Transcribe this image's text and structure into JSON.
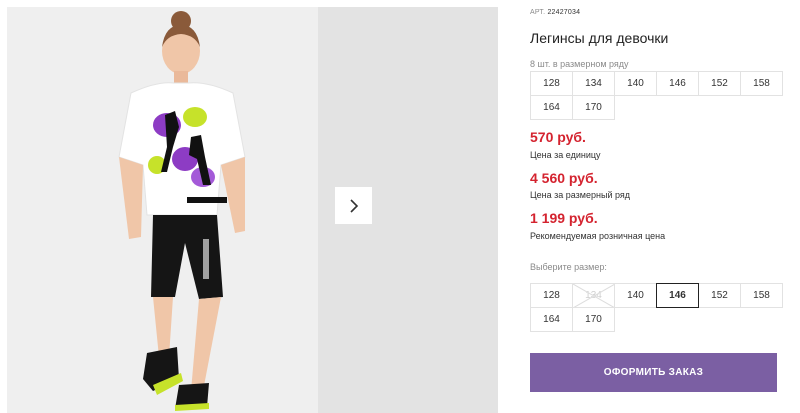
{
  "product": {
    "art_prefix": "АРТ.",
    "art_number": "22427034",
    "title": "Легинсы для девочки",
    "pack_note": "8 шт. в размерном ряду"
  },
  "pack_sizes": [
    "128",
    "134",
    "140",
    "146",
    "152",
    "158",
    "164",
    "170"
  ],
  "prices": {
    "unit_price": "570 руб.",
    "unit_label": "Цена за единицу",
    "row_price": "4 560 руб.",
    "row_label": "Цена за размерный ряд",
    "retail_price": "1 199 руб.",
    "retail_label": "Рекомендуемая розничная цена"
  },
  "size_picker": {
    "label": "Выберите размер:",
    "sizes": [
      "128",
      "134",
      "140",
      "146",
      "152",
      "158",
      "164",
      "170"
    ],
    "selected": "146",
    "unavailable": [
      "134"
    ]
  },
  "order_button": "ОФОРМИТЬ ЗАКАЗ",
  "colors": {
    "accent": "#7b5fa3",
    "price": "#d4232f"
  },
  "icons": {
    "next": "chevron-right-icon"
  }
}
